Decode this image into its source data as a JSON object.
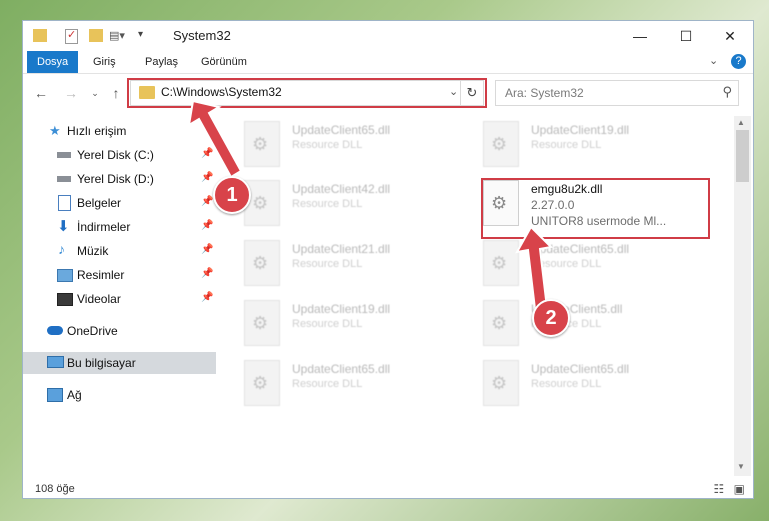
{
  "window": {
    "title": "System32"
  },
  "ribbon": {
    "tabs": [
      "Dosya",
      "Giriş",
      "Paylaş",
      "Görünüm"
    ]
  },
  "address": {
    "path": "C:\\Windows\\System32"
  },
  "search": {
    "placeholder": "Ara: System32"
  },
  "nav": {
    "items": [
      {
        "label": "Hızlı erişim",
        "icon": "star-icon"
      },
      {
        "label": "Yerel Disk (C:)",
        "icon": "drive-icon",
        "pinned": true
      },
      {
        "label": "Yerel Disk (D:)",
        "icon": "drive-icon",
        "pinned": true
      },
      {
        "label": "Belgeler",
        "icon": "documents-icon",
        "pinned": true
      },
      {
        "label": "İndirmeler",
        "icon": "download-icon",
        "pinned": true
      },
      {
        "label": "Müzik",
        "icon": "music-icon",
        "pinned": true
      },
      {
        "label": "Resimler",
        "icon": "pictures-icon",
        "pinned": true
      },
      {
        "label": "Videolar",
        "icon": "video-icon",
        "pinned": true
      },
      {
        "label": "OneDrive",
        "icon": "cloud-icon"
      },
      {
        "label": "Bu bilgisayar",
        "icon": "computer-icon",
        "selected": true
      },
      {
        "label": "Ağ",
        "icon": "network-icon"
      }
    ]
  },
  "files": [
    {
      "name": "UpdateClient65.dll",
      "type": "Resource DLL"
    },
    {
      "name": "UpdateClient19.dll",
      "type": "Resource DLL"
    },
    {
      "name": "UpdateClient42.dll",
      "type": "Resource DLL"
    },
    {
      "name": "UpdateClient21.dll",
      "type": "Resource DLL"
    },
    {
      "name": "UpdateClient65.dll",
      "type": "Resource DLL"
    },
    {
      "name": "UpdateClient19.dll",
      "type": "Resource DLL"
    },
    {
      "name": "UpdateClient5.dll",
      "type": "Resource DLL"
    },
    {
      "name": "UpdateClient65.dll",
      "type": "Resource DLL"
    },
    {
      "name": "UpdateClient65.dll",
      "type": "Resource DLL"
    }
  ],
  "highlighted_file": {
    "name": "emgu8u2k.dll",
    "version": "2.27.0.0",
    "description": "UNITOR8 usermode Ml..."
  },
  "callouts": [
    "1",
    "2"
  ],
  "status": {
    "count": "108 öğe"
  },
  "colors": {
    "accent": "#1979ca",
    "callout": "#d8434a"
  }
}
